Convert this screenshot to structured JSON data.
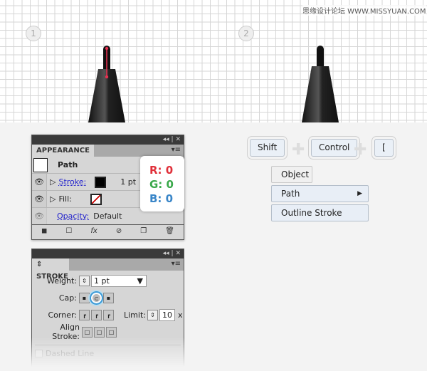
{
  "watermark": "思缘设计论坛 WWW.MISSYUAN.COM",
  "steps": [
    "1",
    "2"
  ],
  "appearance": {
    "title": "APPEARANCE",
    "object": "Path",
    "stroke_label": "Stroke:",
    "stroke_weight": "1 pt",
    "fill_label": "Fill:",
    "opacity_label": "Opacity:",
    "opacity_value": "Default",
    "fx": "fx"
  },
  "rgb": {
    "r": "R: 0",
    "g": "G: 0",
    "b": "B: 0",
    "colors": {
      "r": "#e0303a",
      "g": "#3aa84a",
      "b": "#3a86c8"
    }
  },
  "stroke": {
    "title": "STROKE",
    "weight_label": "Weight:",
    "weight_value": "1 pt",
    "cap_label": "Cap:",
    "corner_label": "Corner:",
    "limit_label": "Limit:",
    "limit_value": "10",
    "limit_unit": "x",
    "align_label": "Align Stroke:",
    "dashed_label": "Dashed Line"
  },
  "keys": [
    "Shift",
    "Control",
    "["
  ],
  "menu": {
    "top": "Object",
    "items": [
      "Path",
      "Outline Stroke"
    ]
  }
}
